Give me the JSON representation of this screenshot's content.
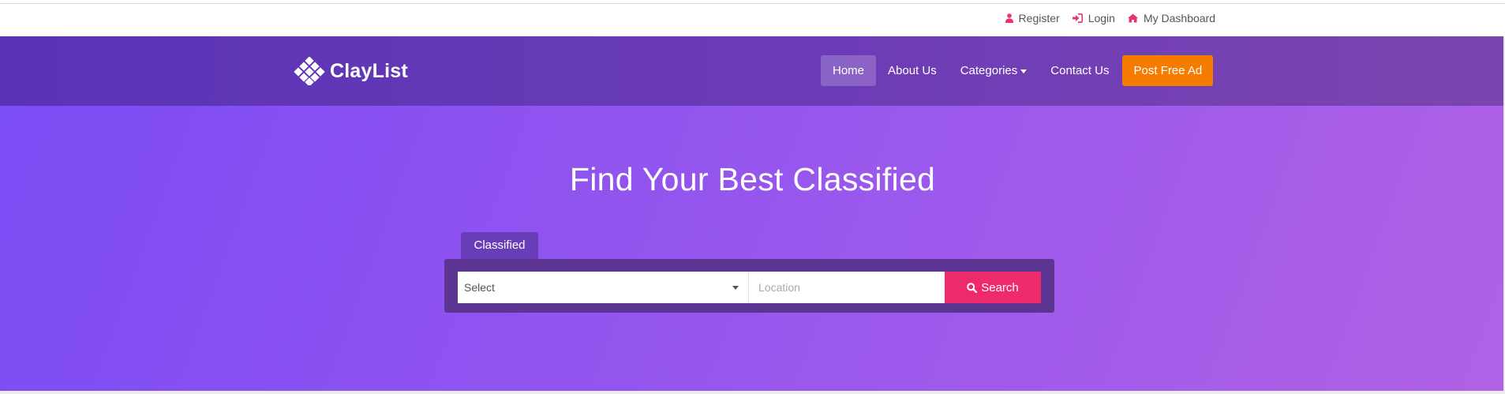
{
  "topbar": {
    "links": [
      {
        "label": "Register",
        "icon": "user-icon"
      },
      {
        "label": "Login",
        "icon": "sign-in-icon"
      },
      {
        "label": "My Dashboard",
        "icon": "home-icon"
      }
    ]
  },
  "brand": {
    "name": "ClayList",
    "logo_icon": "diamond-grid-logo-icon"
  },
  "nav": {
    "items": [
      "Home",
      "About Us",
      "Categories",
      "Contact Us"
    ],
    "active": "Home",
    "cta": "Post Free Ad"
  },
  "hero": {
    "title": "Find Your Best Classified",
    "tab_label": "Classified",
    "select_value": "Select",
    "location_placeholder": "Location",
    "search_label": "Search"
  },
  "colors": {
    "nav_background": "#6b3cb6",
    "hero_gradient_start": "#7c4cf5",
    "hero_gradient_end": "#b062e6",
    "cta_orange": "#f57c00",
    "search_pink": "#ef2a6b",
    "topbar_icon_pink": "#e8336e",
    "search_box_background": "#5c3592"
  }
}
